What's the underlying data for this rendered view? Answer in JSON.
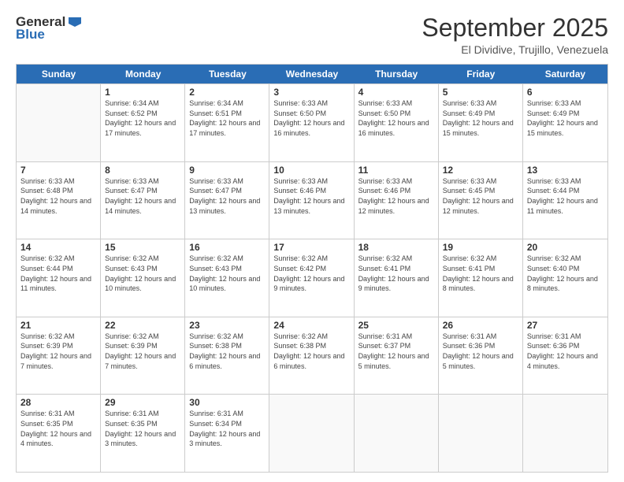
{
  "logo": {
    "general": "General",
    "blue": "Blue"
  },
  "header": {
    "month": "September 2025",
    "location": "El Dividive, Trujillo, Venezuela"
  },
  "days_of_week": [
    "Sunday",
    "Monday",
    "Tuesday",
    "Wednesday",
    "Thursday",
    "Friday",
    "Saturday"
  ],
  "weeks": [
    [
      {
        "day": "",
        "info": ""
      },
      {
        "day": "1",
        "info": "Sunrise: 6:34 AM\nSunset: 6:52 PM\nDaylight: 12 hours and 17 minutes."
      },
      {
        "day": "2",
        "info": "Sunrise: 6:34 AM\nSunset: 6:51 PM\nDaylight: 12 hours and 17 minutes."
      },
      {
        "day": "3",
        "info": "Sunrise: 6:33 AM\nSunset: 6:50 PM\nDaylight: 12 hours and 16 minutes."
      },
      {
        "day": "4",
        "info": "Sunrise: 6:33 AM\nSunset: 6:50 PM\nDaylight: 12 hours and 16 minutes."
      },
      {
        "day": "5",
        "info": "Sunrise: 6:33 AM\nSunset: 6:49 PM\nDaylight: 12 hours and 15 minutes."
      },
      {
        "day": "6",
        "info": "Sunrise: 6:33 AM\nSunset: 6:49 PM\nDaylight: 12 hours and 15 minutes."
      }
    ],
    [
      {
        "day": "7",
        "info": "Sunrise: 6:33 AM\nSunset: 6:48 PM\nDaylight: 12 hours and 14 minutes."
      },
      {
        "day": "8",
        "info": "Sunrise: 6:33 AM\nSunset: 6:47 PM\nDaylight: 12 hours and 14 minutes."
      },
      {
        "day": "9",
        "info": "Sunrise: 6:33 AM\nSunset: 6:47 PM\nDaylight: 12 hours and 13 minutes."
      },
      {
        "day": "10",
        "info": "Sunrise: 6:33 AM\nSunset: 6:46 PM\nDaylight: 12 hours and 13 minutes."
      },
      {
        "day": "11",
        "info": "Sunrise: 6:33 AM\nSunset: 6:46 PM\nDaylight: 12 hours and 12 minutes."
      },
      {
        "day": "12",
        "info": "Sunrise: 6:33 AM\nSunset: 6:45 PM\nDaylight: 12 hours and 12 minutes."
      },
      {
        "day": "13",
        "info": "Sunrise: 6:33 AM\nSunset: 6:44 PM\nDaylight: 12 hours and 11 minutes."
      }
    ],
    [
      {
        "day": "14",
        "info": "Sunrise: 6:32 AM\nSunset: 6:44 PM\nDaylight: 12 hours and 11 minutes."
      },
      {
        "day": "15",
        "info": "Sunrise: 6:32 AM\nSunset: 6:43 PM\nDaylight: 12 hours and 10 minutes."
      },
      {
        "day": "16",
        "info": "Sunrise: 6:32 AM\nSunset: 6:43 PM\nDaylight: 12 hours and 10 minutes."
      },
      {
        "day": "17",
        "info": "Sunrise: 6:32 AM\nSunset: 6:42 PM\nDaylight: 12 hours and 9 minutes."
      },
      {
        "day": "18",
        "info": "Sunrise: 6:32 AM\nSunset: 6:41 PM\nDaylight: 12 hours and 9 minutes."
      },
      {
        "day": "19",
        "info": "Sunrise: 6:32 AM\nSunset: 6:41 PM\nDaylight: 12 hours and 8 minutes."
      },
      {
        "day": "20",
        "info": "Sunrise: 6:32 AM\nSunset: 6:40 PM\nDaylight: 12 hours and 8 minutes."
      }
    ],
    [
      {
        "day": "21",
        "info": "Sunrise: 6:32 AM\nSunset: 6:39 PM\nDaylight: 12 hours and 7 minutes."
      },
      {
        "day": "22",
        "info": "Sunrise: 6:32 AM\nSunset: 6:39 PM\nDaylight: 12 hours and 7 minutes."
      },
      {
        "day": "23",
        "info": "Sunrise: 6:32 AM\nSunset: 6:38 PM\nDaylight: 12 hours and 6 minutes."
      },
      {
        "day": "24",
        "info": "Sunrise: 6:32 AM\nSunset: 6:38 PM\nDaylight: 12 hours and 6 minutes."
      },
      {
        "day": "25",
        "info": "Sunrise: 6:31 AM\nSunset: 6:37 PM\nDaylight: 12 hours and 5 minutes."
      },
      {
        "day": "26",
        "info": "Sunrise: 6:31 AM\nSunset: 6:36 PM\nDaylight: 12 hours and 5 minutes."
      },
      {
        "day": "27",
        "info": "Sunrise: 6:31 AM\nSunset: 6:36 PM\nDaylight: 12 hours and 4 minutes."
      }
    ],
    [
      {
        "day": "28",
        "info": "Sunrise: 6:31 AM\nSunset: 6:35 PM\nDaylight: 12 hours and 4 minutes."
      },
      {
        "day": "29",
        "info": "Sunrise: 6:31 AM\nSunset: 6:35 PM\nDaylight: 12 hours and 3 minutes."
      },
      {
        "day": "30",
        "info": "Sunrise: 6:31 AM\nSunset: 6:34 PM\nDaylight: 12 hours and 3 minutes."
      },
      {
        "day": "",
        "info": ""
      },
      {
        "day": "",
        "info": ""
      },
      {
        "day": "",
        "info": ""
      },
      {
        "day": "",
        "info": ""
      }
    ]
  ]
}
